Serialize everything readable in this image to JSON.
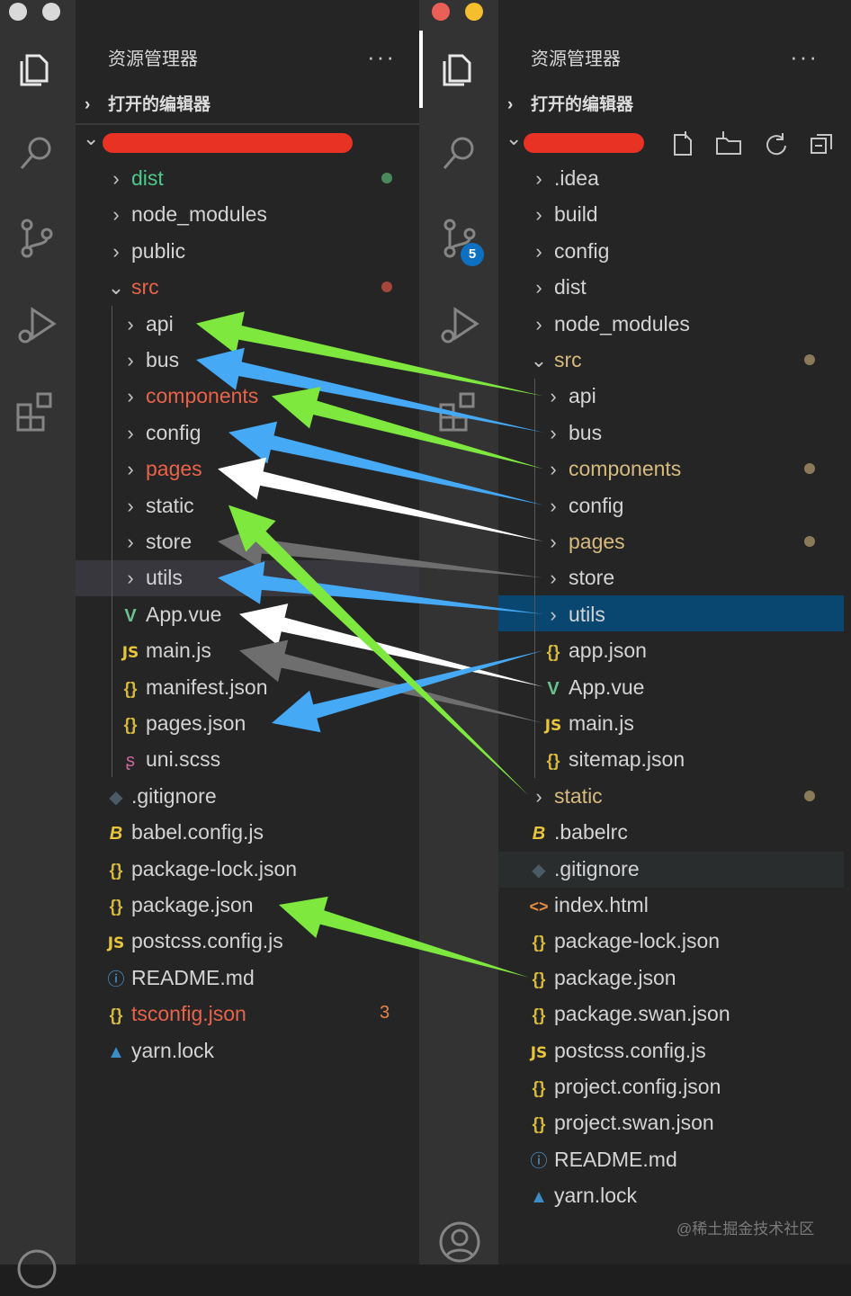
{
  "left": {
    "explorer_title": "资源管理器",
    "more_label": "···",
    "open_editors_label": "打开的编辑器",
    "tree": [
      {
        "name": "dist",
        "kind": "folder",
        "color": "#4ec98b",
        "mark": "#4a8a5a"
      },
      {
        "name": "node_modules",
        "kind": "folder"
      },
      {
        "name": "public",
        "kind": "folder"
      },
      {
        "name": "src",
        "kind": "folder-open",
        "color": "#e8634a",
        "mark": "#a3463b"
      },
      {
        "name": "api",
        "kind": "folder",
        "level": 2
      },
      {
        "name": "bus",
        "kind": "folder",
        "level": 2
      },
      {
        "name": "components",
        "kind": "folder",
        "level": 2,
        "color": "#e8634a"
      },
      {
        "name": "config",
        "kind": "folder",
        "level": 2
      },
      {
        "name": "pages",
        "kind": "folder",
        "level": 2,
        "color": "#e8634a"
      },
      {
        "name": "static",
        "kind": "folder",
        "level": 2
      },
      {
        "name": "store",
        "kind": "folder",
        "level": 2
      },
      {
        "name": "utils",
        "kind": "folder",
        "level": 2,
        "selected": true
      },
      {
        "name": "App.vue",
        "kind": "vue",
        "level": 2
      },
      {
        "name": "main.js",
        "kind": "js",
        "level": 2
      },
      {
        "name": "manifest.json",
        "kind": "json",
        "level": 2
      },
      {
        "name": "pages.json",
        "kind": "json",
        "level": 2
      },
      {
        "name": "uni.scss",
        "kind": "scss",
        "level": 2
      },
      {
        "name": ".gitignore",
        "kind": "git"
      },
      {
        "name": "babel.config.js",
        "kind": "babel"
      },
      {
        "name": "package-lock.json",
        "kind": "json"
      },
      {
        "name": "package.json",
        "kind": "json"
      },
      {
        "name": "postcss.config.js",
        "kind": "js"
      },
      {
        "name": "README.md",
        "kind": "info"
      },
      {
        "name": "tsconfig.json",
        "kind": "json",
        "color": "#e8634a",
        "badge": "3"
      },
      {
        "name": "yarn.lock",
        "kind": "yarn"
      }
    ]
  },
  "right": {
    "explorer_title": "资源管理器",
    "more_label": "···",
    "open_editors_label": "打开的编辑器",
    "scm_badge": "5",
    "tree": [
      {
        "name": ".idea",
        "kind": "folder"
      },
      {
        "name": "build",
        "kind": "folder"
      },
      {
        "name": "config",
        "kind": "folder"
      },
      {
        "name": "dist",
        "kind": "folder"
      },
      {
        "name": "node_modules",
        "kind": "folder"
      },
      {
        "name": "src",
        "kind": "folder-open",
        "color": "#d7ba7d",
        "mark": "#8a7a5a"
      },
      {
        "name": "api",
        "kind": "folder",
        "level": 2
      },
      {
        "name": "bus",
        "kind": "folder",
        "level": 2
      },
      {
        "name": "components",
        "kind": "folder",
        "level": 2,
        "color": "#d7ba7d",
        "mark": "#8a7a5a"
      },
      {
        "name": "config",
        "kind": "folder",
        "level": 2
      },
      {
        "name": "pages",
        "kind": "folder",
        "level": 2,
        "color": "#d7ba7d",
        "mark": "#8a7a5a"
      },
      {
        "name": "store",
        "kind": "folder",
        "level": 2
      },
      {
        "name": "utils",
        "kind": "folder",
        "level": 2,
        "selected": true
      },
      {
        "name": "app.json",
        "kind": "json",
        "level": 2
      },
      {
        "name": "App.vue",
        "kind": "vue",
        "level": 2
      },
      {
        "name": "main.js",
        "kind": "js",
        "level": 2
      },
      {
        "name": "sitemap.json",
        "kind": "json",
        "level": 2
      },
      {
        "name": "static",
        "kind": "folder",
        "color": "#d7ba7d",
        "mark": "#8a7a5a"
      },
      {
        "name": ".babelrc",
        "kind": "babel"
      },
      {
        "name": ".gitignore",
        "kind": "git",
        "hover": true
      },
      {
        "name": "index.html",
        "kind": "html"
      },
      {
        "name": "package-lock.json",
        "kind": "json"
      },
      {
        "name": "package.json",
        "kind": "json"
      },
      {
        "name": "package.swan.json",
        "kind": "json"
      },
      {
        "name": "postcss.config.js",
        "kind": "js"
      },
      {
        "name": "project.config.json",
        "kind": "json"
      },
      {
        "name": "project.swan.json",
        "kind": "json"
      },
      {
        "name": "README.md",
        "kind": "info"
      },
      {
        "name": "yarn.lock",
        "kind": "yarn"
      }
    ]
  },
  "watermark": "@稀土掘金技术社区",
  "colors": {
    "activity_bar": "#333333",
    "sidebar": "#252526",
    "selection": "#094771",
    "arrow_green": "#7ee83f",
    "arrow_blue": "#45a9f5",
    "arrow_white": "#ffffff",
    "arrow_gray": "#6e6e6e",
    "redaction": "#e83223"
  },
  "annotations": [
    {
      "from": "right.api",
      "to": "left.api",
      "color": "green"
    },
    {
      "from": "right.bus",
      "to": "left.bus",
      "color": "blue"
    },
    {
      "from": "right.components",
      "to": "left.components",
      "color": "green"
    },
    {
      "from": "right.config",
      "to": "left.config",
      "color": "blue"
    },
    {
      "from": "right.pages",
      "to": "left.pages",
      "color": "white"
    },
    {
      "from": "right.store",
      "to": "left.store",
      "color": "gray"
    },
    {
      "from": "right.utils",
      "to": "left.utils",
      "color": "blue"
    },
    {
      "from": "right.App.vue",
      "to": "left.App.vue",
      "color": "white"
    },
    {
      "from": "right.main.js",
      "to": "left.main.js",
      "color": "gray"
    },
    {
      "from": "right.app.json",
      "to": "left.pages.json",
      "color": "blue"
    },
    {
      "from": "right.static",
      "to": "left.static",
      "color": "green"
    },
    {
      "from": "right.package.json",
      "to": "left.package.json",
      "color": "green"
    }
  ]
}
